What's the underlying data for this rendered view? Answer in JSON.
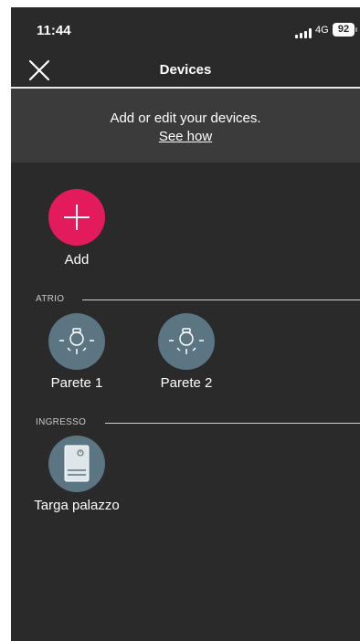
{
  "status_bar": {
    "time": "11:44",
    "network": "4G",
    "battery": "92"
  },
  "header": {
    "title": "Devices",
    "close_icon": "close-icon"
  },
  "banner": {
    "text": "Add or edit your devices.",
    "link": "See how"
  },
  "add": {
    "label": "Add",
    "icon": "plus-icon",
    "color": "#e31b5d"
  },
  "sections": [
    {
      "title": "ATRIO",
      "devices": [
        {
          "label": "Parete 1",
          "icon": "light-bulb-icon"
        },
        {
          "label": "Parete 2",
          "icon": "light-bulb-icon"
        }
      ]
    },
    {
      "title": "INGRESSO",
      "devices": [
        {
          "label": "Targa palazzo",
          "icon": "entrance-panel-icon"
        }
      ]
    }
  ],
  "colors": {
    "background": "#2a2a2a",
    "banner": "#3b3b3b",
    "device_circle": "#5c7582",
    "accent": "#e31b5d"
  }
}
